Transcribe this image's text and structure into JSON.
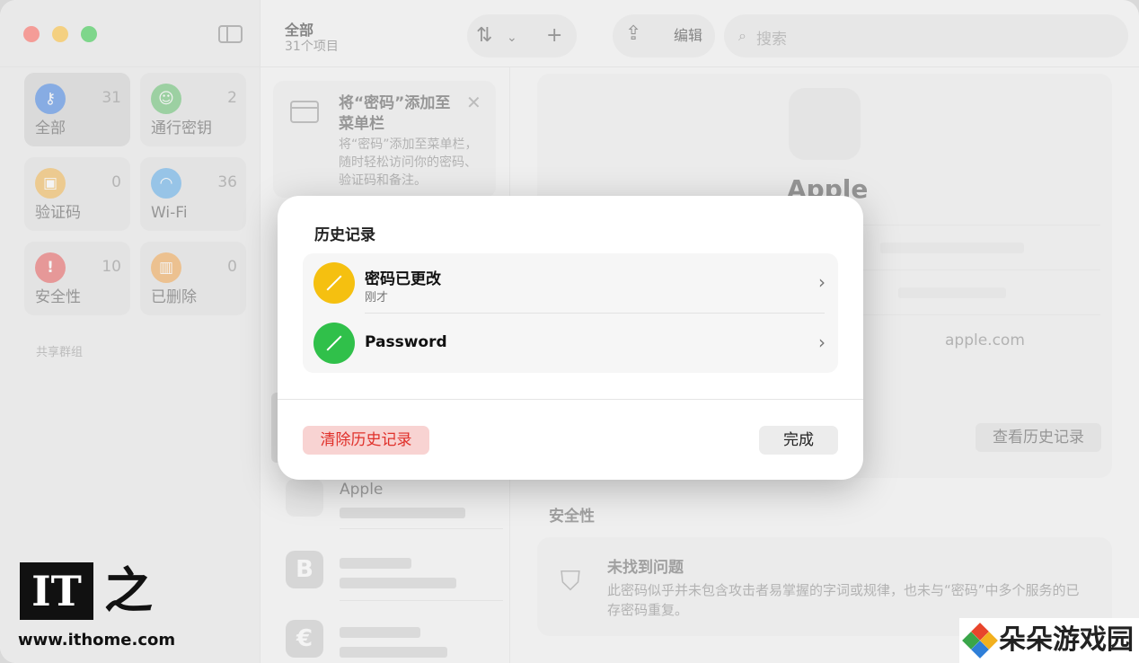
{
  "window": {
    "sidebar": {
      "categories": [
        {
          "label": "全部",
          "count": "31",
          "icon": "key-icon"
        },
        {
          "label": "通行密钥",
          "count": "2",
          "icon": "person-badge-icon"
        },
        {
          "label": "验证码",
          "count": "0",
          "icon": "lock-icon"
        },
        {
          "label": "Wi-Fi",
          "count": "36",
          "icon": "wifi-icon"
        },
        {
          "label": "安全性",
          "count": "10",
          "icon": "exclamation-icon"
        },
        {
          "label": "已删除",
          "count": "0",
          "icon": "trash-icon"
        }
      ],
      "shared_groups_label": "共享群组"
    },
    "toolbar": {
      "list_title": "全部",
      "list_subtitle": "31个项目",
      "edit_label": "编辑",
      "search_placeholder": "搜索"
    },
    "tip": {
      "title": "将“密码”添加至菜单栏",
      "body": "将“密码”添加至菜单栏，随时轻松访问你的密码、验证码和备注。"
    },
    "list": [
      {
        "title": "Apple",
        "icon_letter": ""
      },
      {
        "title": "",
        "icon_letter": "B"
      },
      {
        "title": "",
        "icon_letter": "€"
      }
    ],
    "detail": {
      "title": "Apple",
      "website": "apple.com",
      "view_history_label": "查看历史记录",
      "security_heading": "安全性",
      "security_title": "未找到问题",
      "security_body": "此密码似乎并未包含攻击者易掌握的字词或规律，也未与“密码”中多个服务的已存密码重复。"
    }
  },
  "modal": {
    "title": "历史记录",
    "entries": [
      {
        "title": "密码已更改",
        "subtitle": "刚才",
        "color": "#f5c010"
      },
      {
        "title": "Password",
        "subtitle": "",
        "color": "#30c04a"
      }
    ],
    "clear_label": "清除历史记录",
    "done_label": "完成"
  },
  "watermarks": {
    "ithome_logo": "IT之家",
    "ithome_url": "www.ithome.com",
    "duoduo_text": "朵朵游戏园"
  }
}
